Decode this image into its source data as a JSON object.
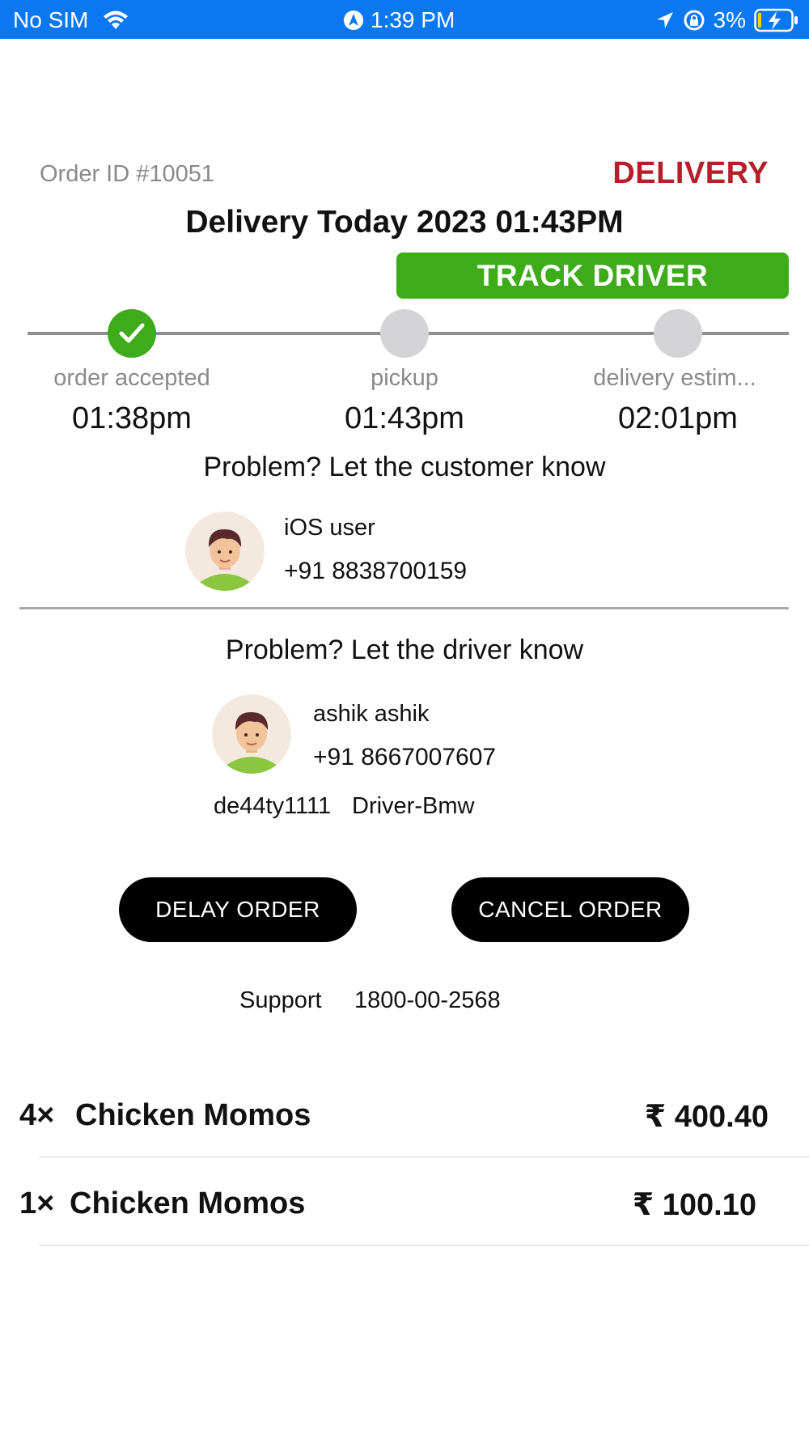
{
  "status_bar": {
    "carrier": "No SIM",
    "time": "1:39 PM",
    "battery": "3%",
    "color": "#0b78f2"
  },
  "order": {
    "id_label": "Order ID #10051",
    "type": "DELIVERY",
    "title": "Delivery Today 2023 01:43PM",
    "track_button": "TRACK DRIVER"
  },
  "timeline": {
    "steps": [
      {
        "label": "order accepted",
        "time": "01:38pm",
        "done": true
      },
      {
        "label": "pickup",
        "time": "01:43pm",
        "done": false
      },
      {
        "label": "delivery estim...",
        "time": "02:01pm",
        "done": false
      }
    ]
  },
  "customer": {
    "heading": "Problem? Let the customer know",
    "name": "iOS user",
    "phone": "+91 8838700159"
  },
  "driver": {
    "heading": "Problem? Let the driver know",
    "name": "ashik ashik",
    "phone": "+91 8667007607",
    "plate": "de44ty1111",
    "vehicle": "Driver-Bmw"
  },
  "actions": {
    "delay": "DELAY ORDER",
    "cancel": "CANCEL ORDER"
  },
  "support": {
    "label": "Support",
    "phone": "1800-00-2568"
  },
  "items": [
    {
      "qty": "4×",
      "name": "Chicken Momos",
      "price": "₹ 400.40"
    },
    {
      "qty": "1×",
      "name": "Chicken Momos",
      "price": "₹ 100.10"
    }
  ],
  "colors": {
    "accent_green": "#3dac18",
    "delivery_red": "#b3202a"
  }
}
